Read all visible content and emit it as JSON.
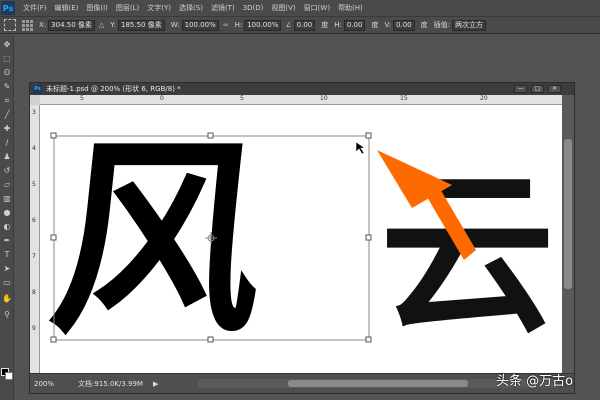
{
  "app": {
    "logo_text": "Ps"
  },
  "menu": {
    "items": [
      "文件(F)",
      "编辑(E)",
      "图像(I)",
      "图层(L)",
      "文字(Y)",
      "选择(S)",
      "滤镜(T)",
      "3D(D)",
      "视图(V)",
      "窗口(W)",
      "帮助(H)"
    ]
  },
  "options_bar": {
    "x_label": "X:",
    "x_value": "304.50 像素",
    "y_label": "Y:",
    "y_value": "185.50 像素",
    "w_label": "W:",
    "w_value": "100.00%",
    "link_glyph": "∞",
    "h_label": "H:",
    "h_value": "100.00%",
    "angle_value": "0.00",
    "angle_unit": "度",
    "hskew_label": "H:",
    "hskew_value": "0.00",
    "hskew_unit": "度",
    "vskew_label": "V:",
    "vskew_value": "0.00",
    "vskew_unit": "度",
    "interp_label": "插值:",
    "interp_value": "两次立方"
  },
  "tools": [
    "move-tool",
    "marquee-tool",
    "lasso-tool",
    "quick-select-tool",
    "crop-tool",
    "eyedropper-tool",
    "healing-tool",
    "brush-tool",
    "stamp-tool",
    "history-brush-tool",
    "eraser-tool",
    "gradient-tool",
    "blur-tool",
    "dodge-tool",
    "pen-tool",
    "type-tool",
    "path-select-tool",
    "shape-tool",
    "hand-tool",
    "zoom-tool"
  ],
  "document": {
    "title": "未标题-1.psd @ 200% (形状 6, RGB/8) *",
    "ruler_top_ticks": [
      "5",
      "0",
      "5",
      "10",
      "15",
      "20"
    ],
    "ruler_left_ticks": [
      "3",
      "4",
      "5",
      "6",
      "7",
      "8",
      "9"
    ],
    "canvas_text_1": "风",
    "canvas_text_2": "云",
    "window_buttons": [
      "—",
      "□",
      "✕"
    ]
  },
  "status": {
    "zoom": "200%",
    "doc_info": "文档:915.0K/3.99M",
    "arrow": "▶"
  },
  "watermark": "头条 @万古o",
  "colors": {
    "accent_arrow": "#ff6a00",
    "ui_dark": "#4a4a4a",
    "canvas_bg": "#ffffff"
  }
}
